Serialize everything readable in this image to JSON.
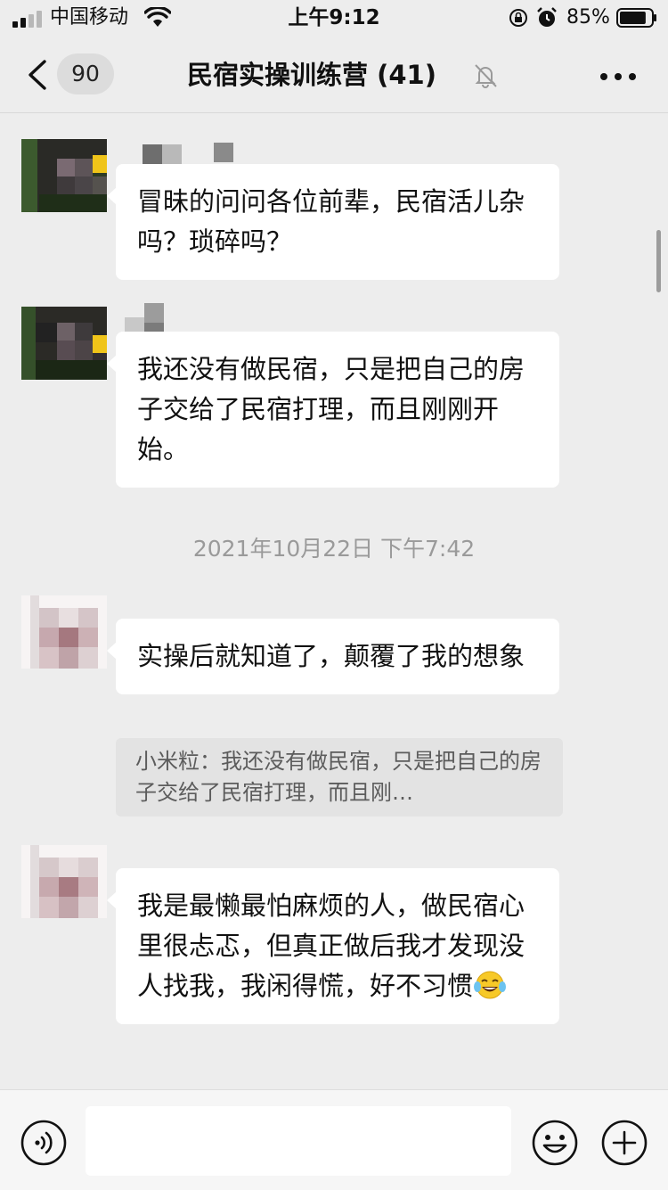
{
  "status_bar": {
    "carrier": "中国移动",
    "time": "上午9:12",
    "battery_percent": "85%",
    "battery_level": 0.85
  },
  "nav": {
    "unread_count": "90",
    "title": "民宿实操训练营 (41)"
  },
  "messages": [
    {
      "text": "冒昧的问问各位前辈，民宿活儿杂吗？琐碎吗？"
    },
    {
      "text": "我还没有做民宿，只是把自己的房子交给了民宿打理，而且刚刚开始。"
    },
    {
      "text": "实操后就知道了，颠覆了我的想象",
      "quote": "小米粒：我还没有做民宿，只是把自己的房子交给了民宿打理，而且刚…"
    },
    {
      "text": "我是最懒最怕麻烦的人，做民宿心里很忐忑，但真正做后我才发现没人找我，我闲得慌，好不习惯",
      "emoji": "face-with-tears-of-joy"
    }
  ],
  "timestamp": "2021年10月22日 下午7:42",
  "icons": {
    "back": "chevron-left-icon",
    "mute": "bell-slash-icon",
    "more": "more-icon",
    "voice": "voice-icon",
    "emoji": "smiley-icon",
    "plus": "plus-icon"
  },
  "colors": {
    "background": "#ededed",
    "bubble": "#ffffff",
    "quote": "#e3e3e3",
    "timestamp": "#9a9a9a"
  }
}
